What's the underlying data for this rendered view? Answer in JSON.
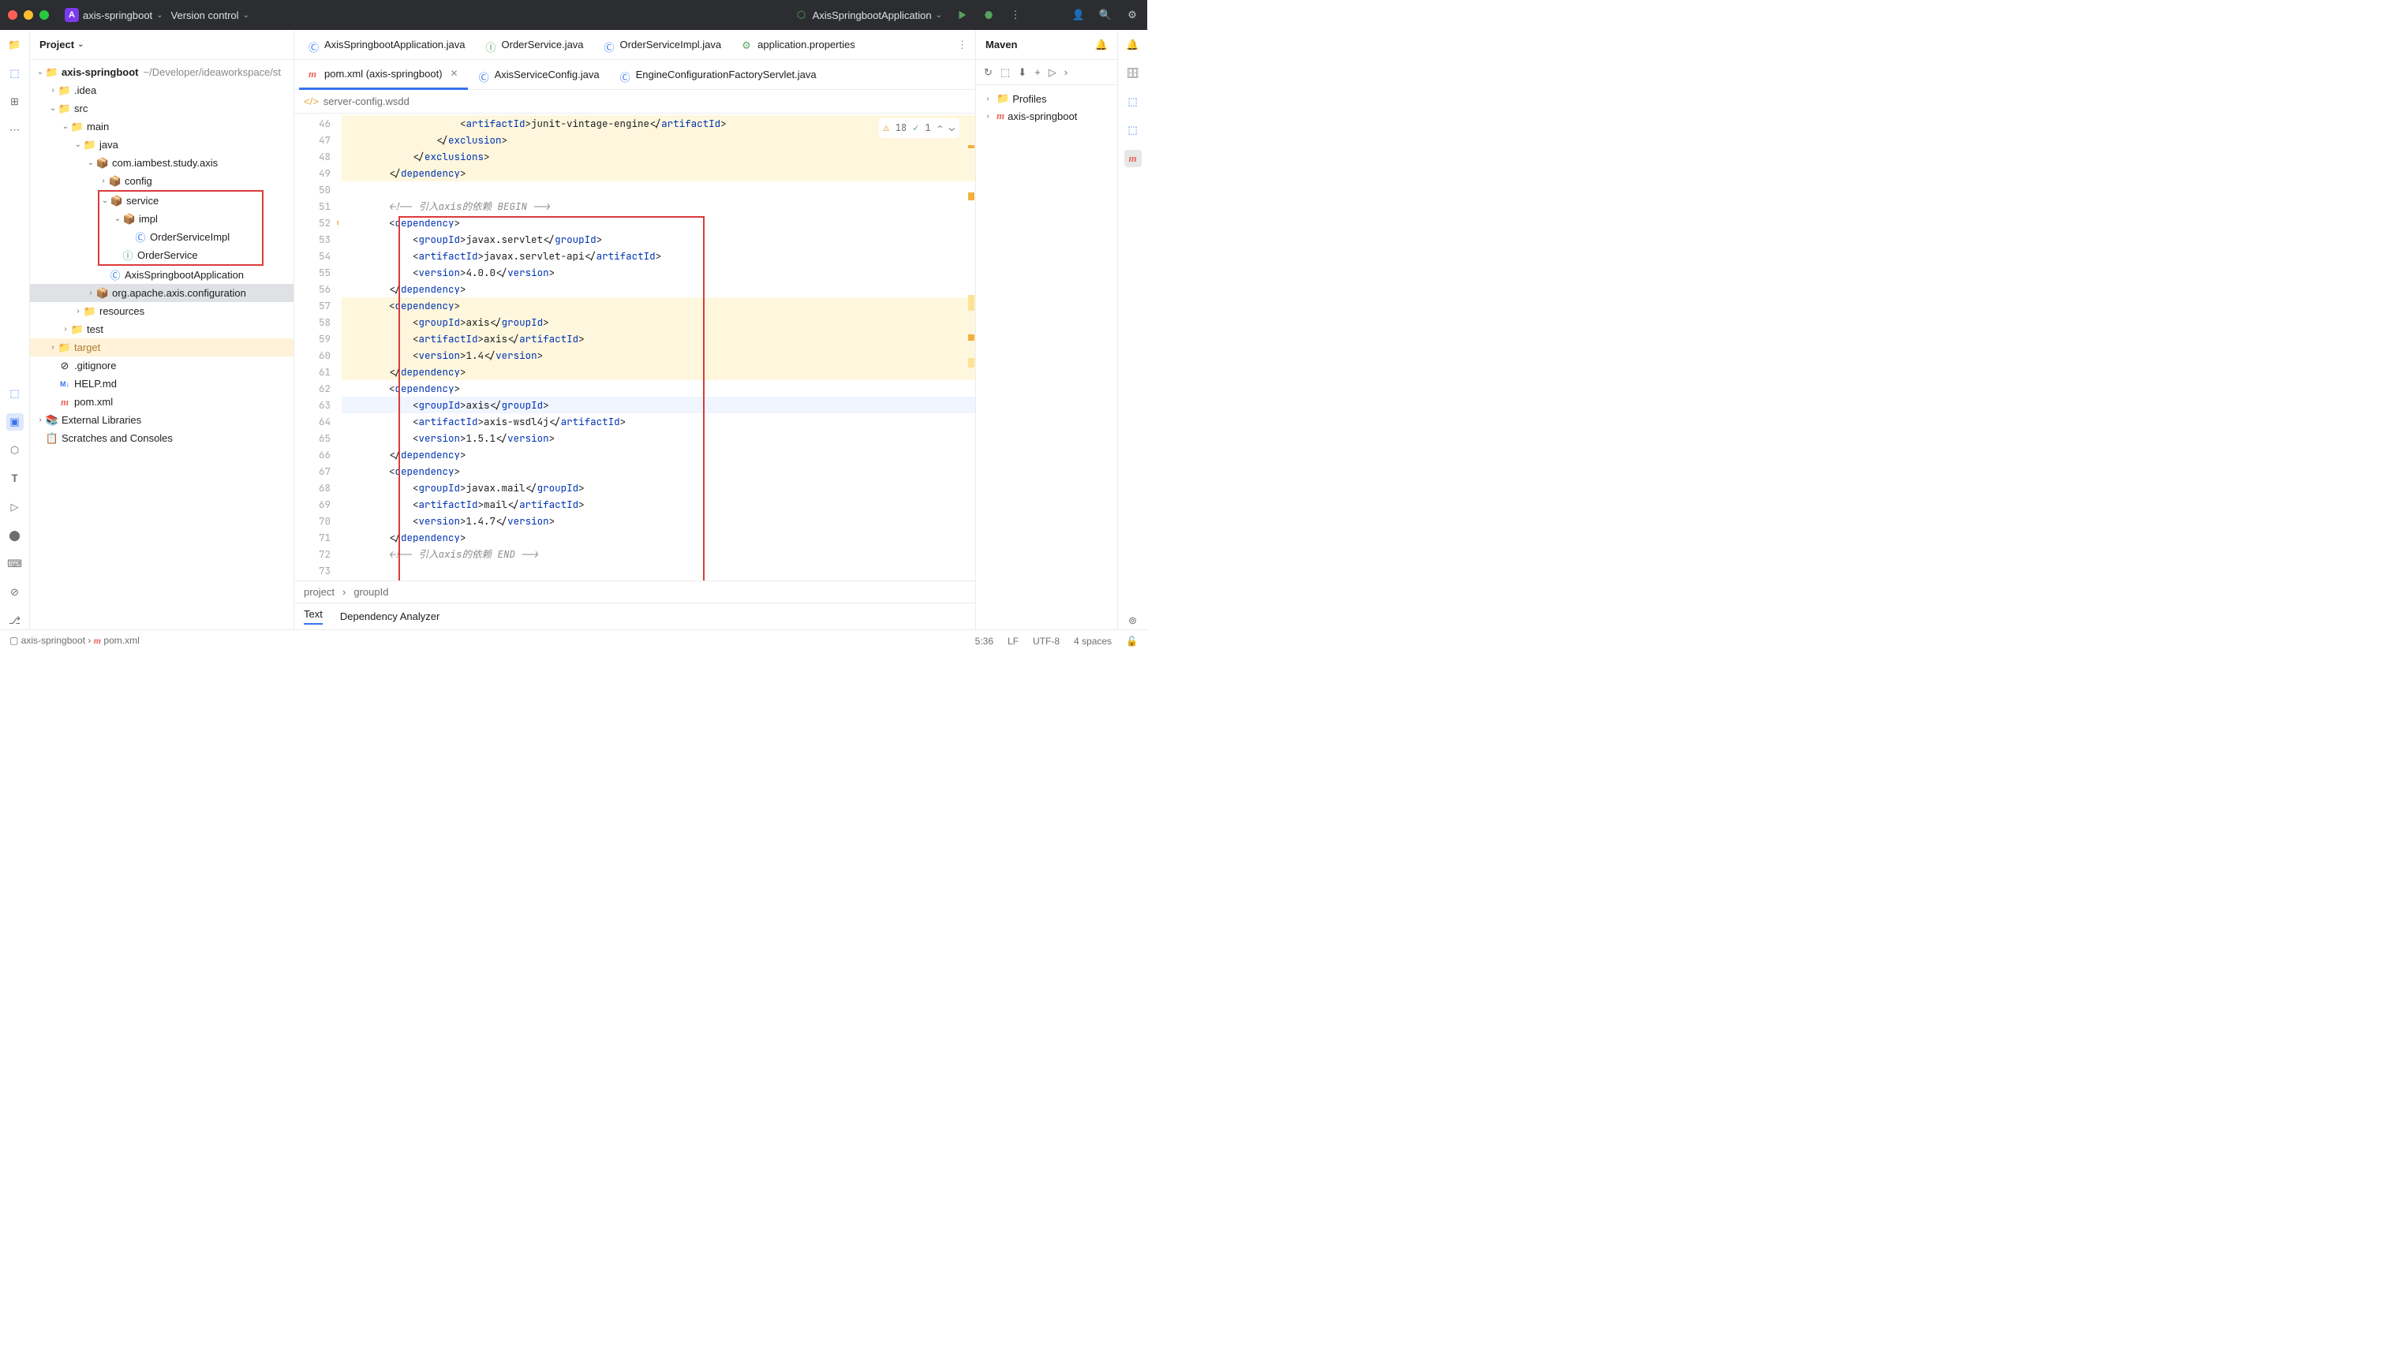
{
  "titlebar": {
    "project": "axis-springboot",
    "vcs": "Version control",
    "run_config": "AxisSpringbootApplication"
  },
  "project_panel": {
    "title": "Project"
  },
  "tree": {
    "root": "axis-springboot",
    "root_path": "~/Developer/ideaworkspace/st",
    "idea": ".idea",
    "src": "src",
    "main": "main",
    "java": "java",
    "pkg": "com.iambest.study.axis",
    "config": "config",
    "service": "service",
    "impl": "impl",
    "orderImpl": "OrderServiceImpl",
    "orderSvc": "OrderService",
    "app": "AxisSpringbootApplication",
    "apache": "org.apache.axis.configuration",
    "resources": "resources",
    "test": "test",
    "target": "target",
    "gitignore": ".gitignore",
    "help": "HELP.md",
    "pom": "pom.xml",
    "extlib": "External Libraries",
    "scratch": "Scratches and Consoles"
  },
  "tabs": {
    "t1": "AxisSpringbootApplication.java",
    "t2": "OrderService.java",
    "t3": "OrderServiceImpl.java",
    "t4": "application.properties",
    "t5": "pom.xml (axis-springboot)",
    "t6": "AxisServiceConfig.java",
    "t7": "EngineConfigurationFactoryServlet.java"
  },
  "crumb": {
    "file": "server-config.wsdd"
  },
  "lines": [
    "46",
    "47",
    "48",
    "49",
    "50",
    "51",
    "52",
    "53",
    "54",
    "55",
    "56",
    "57",
    "58",
    "59",
    "60",
    "61",
    "62",
    "63",
    "64",
    "65",
    "66",
    "67",
    "68",
    "69",
    "70",
    "71",
    "72",
    "73"
  ],
  "code": {
    "l46a": "artifactId",
    "l46b": "junit-vintage-engine",
    "l46c": "artifactId",
    "l47": "exclusion",
    "l48": "exclusions",
    "l49": "dependency",
    "l51": "<!-- 引入axis的依赖 BEGIN -->",
    "l52": "dependency",
    "l53a": "groupId",
    "l53b": "javax.servlet",
    "l53c": "groupId",
    "l54a": "artifactId",
    "l54b": "javax.servlet-api",
    "l54c": "artifactId",
    "l55a": "version",
    "l55b": "4.0.0",
    "l55c": "version",
    "l56": "dependency",
    "l57": "dependency",
    "l58a": "groupId",
    "l58b": "axis",
    "l58c": "groupId",
    "l59a": "artifactId",
    "l59b": "axis",
    "l59c": "artifactId",
    "l60a": "version",
    "l60b": "1.4",
    "l60c": "version",
    "l61": "dependency",
    "l62": "dependency",
    "l63a": "groupId",
    "l63b": "axis",
    "l63c": "groupId",
    "l64a": "artifactId",
    "l64b": "axis-wsdl4j",
    "l64c": "artifactId",
    "l65a": "version",
    "l65b": "1.5.1",
    "l65c": "version",
    "l66": "dependency",
    "l67": "dependency",
    "l68a": "groupId",
    "l68b": "javax.mail",
    "l68c": "groupId",
    "l69a": "artifactId",
    "l69b": "mail",
    "l69c": "artifactId",
    "l70a": "version",
    "l70b": "1.4.7",
    "l70c": "version",
    "l71": "dependency",
    "l72": "<!-- 引入axis的依赖 END -->"
  },
  "inspect": {
    "warn": "18",
    "ok": "1"
  },
  "bcrumb": {
    "a": "project",
    "b": "groupId"
  },
  "subtabs": {
    "text": "Text",
    "dep": "Dependency Analyzer"
  },
  "maven": {
    "title": "Maven",
    "profiles": "Profiles",
    "proj": "axis-springboot"
  },
  "status": {
    "p1": "axis-springboot",
    "p2": "pom.xml",
    "pos": "5:36",
    "lf": "LF",
    "enc": "UTF-8",
    "indent": "4 spaces"
  }
}
